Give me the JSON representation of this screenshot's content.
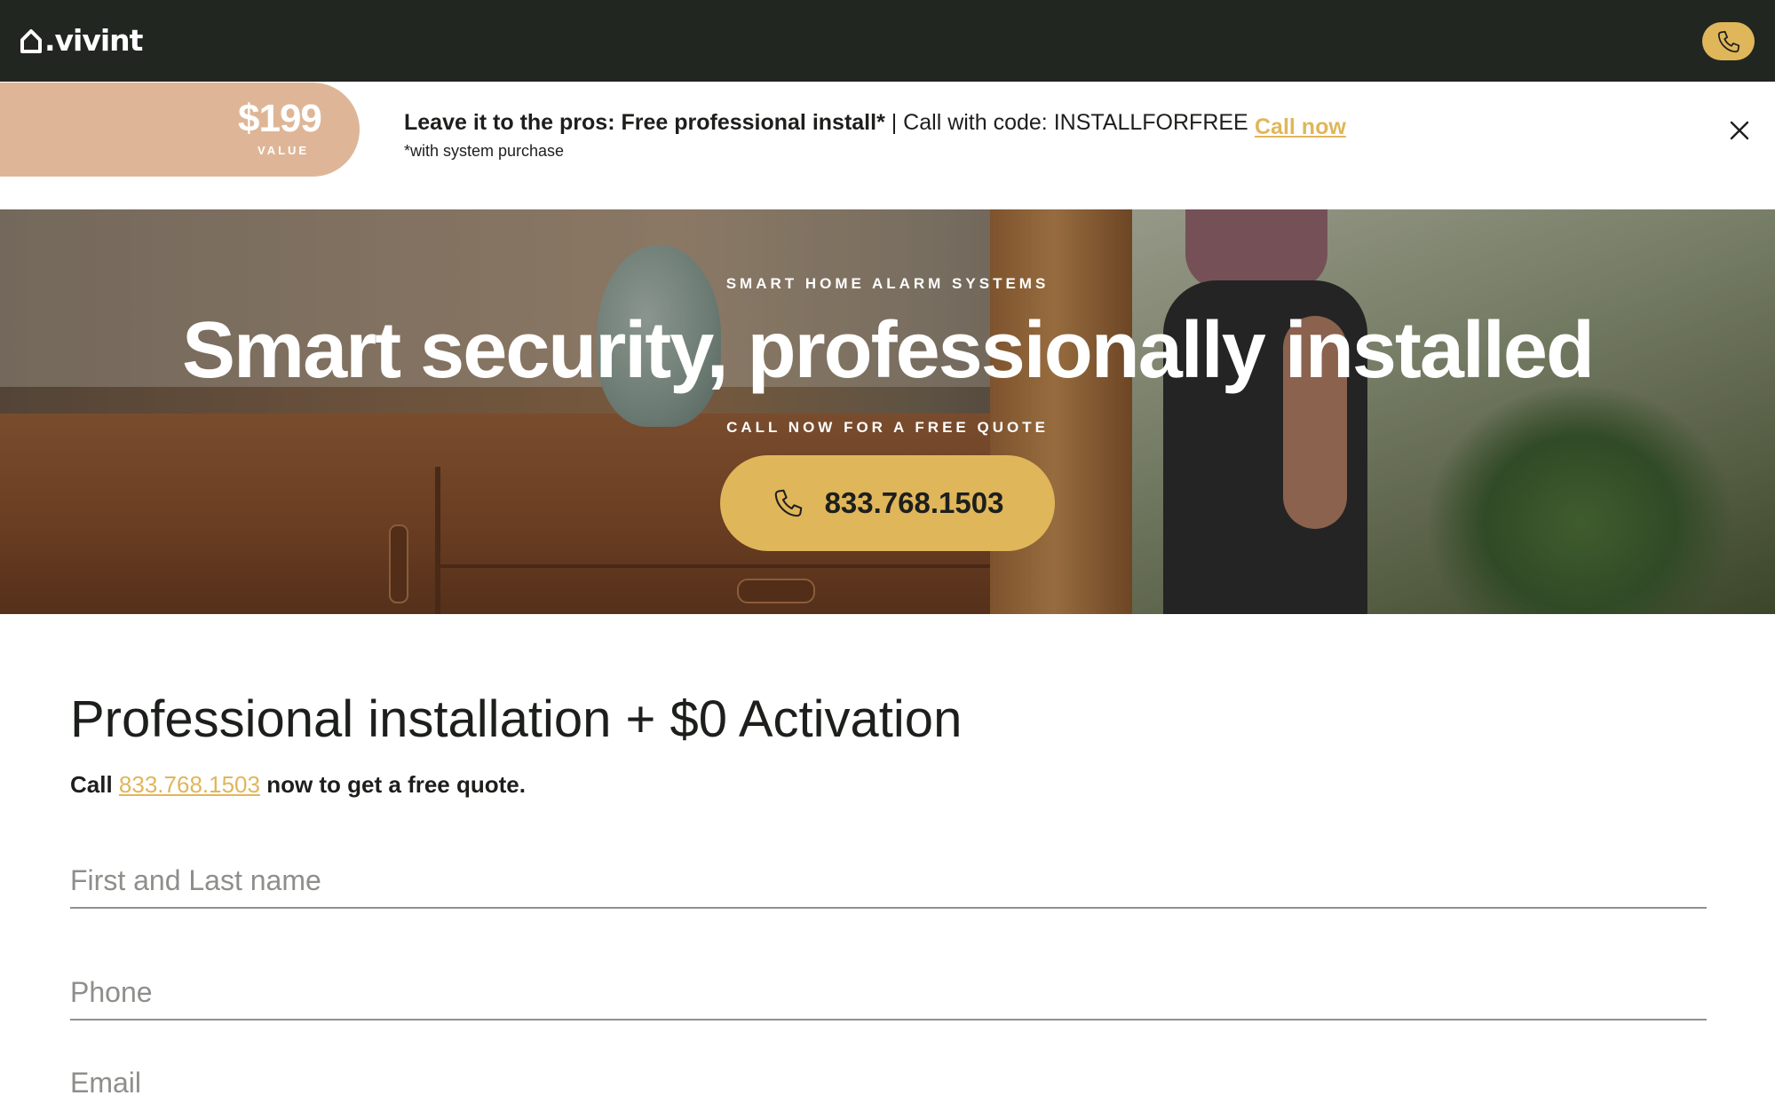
{
  "brand": {
    "logo_text": ".vivint",
    "accent_color": "#e0b65a",
    "nav_color": "#222621",
    "badge_color": "#deb697"
  },
  "nav": {
    "phone_icon": "phone-icon"
  },
  "promo": {
    "badge_amount": "$199",
    "badge_label": "VALUE",
    "headline_bold": "Leave it to the pros: Free professional install*",
    "headline_rest": " | Call with code: INSTALLFORFREE",
    "note": "*with system purchase",
    "link_label": "Call now",
    "close_icon": "close-icon"
  },
  "hero": {
    "eyebrow": "SMART HOME ALARM SYSTEMS",
    "title": "Smart security, professionally installed",
    "subtitle": "CALL NOW FOR A FREE QUOTE",
    "cta_number": "833.768.1503",
    "cta_icon": "phone-icon"
  },
  "offer": {
    "title": "Professional installation + $0 Activation",
    "line_prefix": "Call ",
    "line_phone": "833.768.1503",
    "line_suffix": " now to get a free quote."
  },
  "form": {
    "name_placeholder": "First and Last name",
    "phone_placeholder": "Phone",
    "email_placeholder": "Email"
  }
}
